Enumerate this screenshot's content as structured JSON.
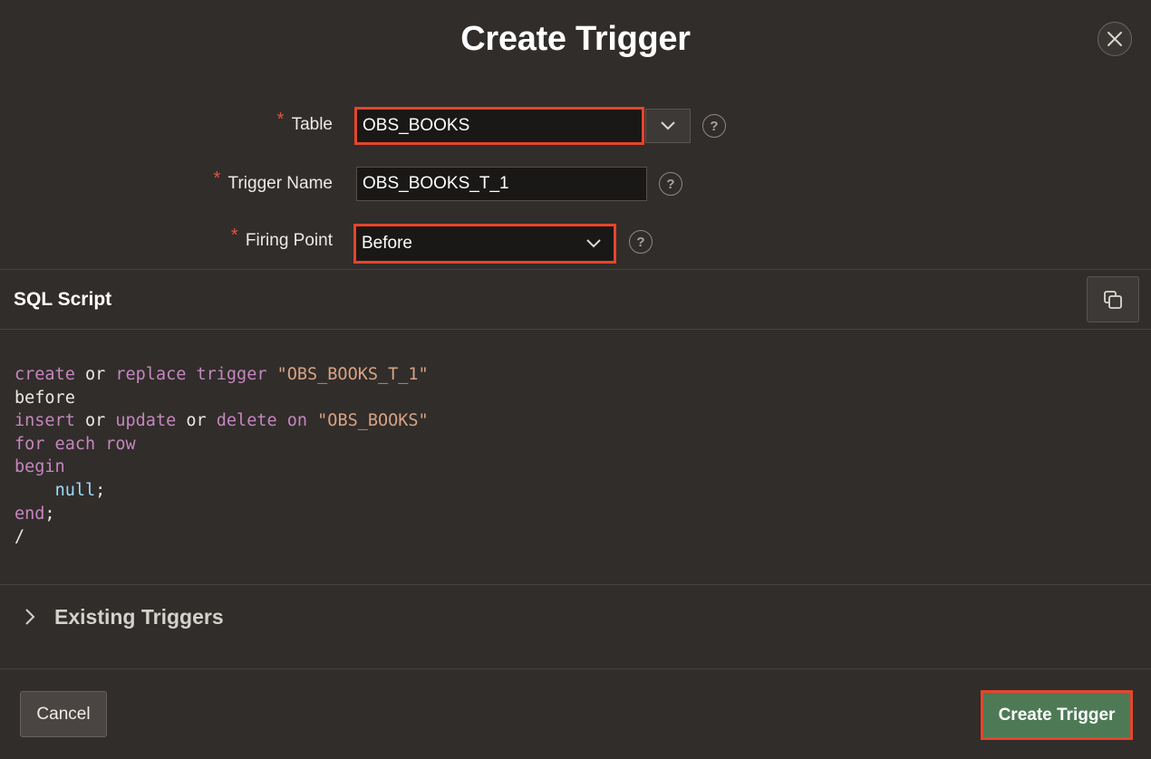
{
  "dialog": {
    "title": "Create Trigger",
    "close_icon": "close-icon"
  },
  "form": {
    "table": {
      "label": "Table",
      "required": "*",
      "value": "OBS_BOOKS",
      "help": "?"
    },
    "trigger_name": {
      "label": "Trigger Name",
      "required": "*",
      "value": "OBS_BOOKS_T_1",
      "help": "?"
    },
    "firing_point": {
      "label": "Firing Point",
      "required": "*",
      "value": "Before",
      "help": "?"
    }
  },
  "sql": {
    "title": "SQL Script",
    "copy_icon": "copy-icon",
    "lines": [
      [
        {
          "t": "kw",
          "v": "create"
        },
        {
          "t": "p",
          "v": " or "
        },
        {
          "t": "kw",
          "v": "replace"
        },
        {
          "t": "p",
          "v": " "
        },
        {
          "t": "kw",
          "v": "trigger"
        },
        {
          "t": "p",
          "v": " "
        },
        {
          "t": "str",
          "v": "\"OBS_BOOKS_T_1\""
        }
      ],
      [
        {
          "t": "p",
          "v": "before"
        }
      ],
      [
        {
          "t": "kw",
          "v": "insert"
        },
        {
          "t": "p",
          "v": " or "
        },
        {
          "t": "kw",
          "v": "update"
        },
        {
          "t": "p",
          "v": " or "
        },
        {
          "t": "kw",
          "v": "delete"
        },
        {
          "t": "p",
          "v": " "
        },
        {
          "t": "kw",
          "v": "on"
        },
        {
          "t": "p",
          "v": " "
        },
        {
          "t": "str",
          "v": "\"OBS_BOOKS\""
        }
      ],
      [
        {
          "t": "kw",
          "v": "for each row"
        }
      ],
      [
        {
          "t": "kw",
          "v": "begin"
        }
      ],
      [
        {
          "t": "p",
          "v": "    "
        },
        {
          "t": "nul",
          "v": "null"
        },
        {
          "t": "p",
          "v": ";"
        }
      ],
      [
        {
          "t": "kw",
          "v": "end"
        },
        {
          "t": "p",
          "v": ";"
        }
      ],
      [
        {
          "t": "p",
          "v": "/"
        }
      ]
    ]
  },
  "existing": {
    "label": "Existing Triggers"
  },
  "footer": {
    "cancel_label": "Cancel",
    "create_label": "Create Trigger"
  },
  "colors": {
    "accent_highlight": "#e5452c",
    "primary_button": "#4d7a55",
    "required": "#e5533e"
  }
}
